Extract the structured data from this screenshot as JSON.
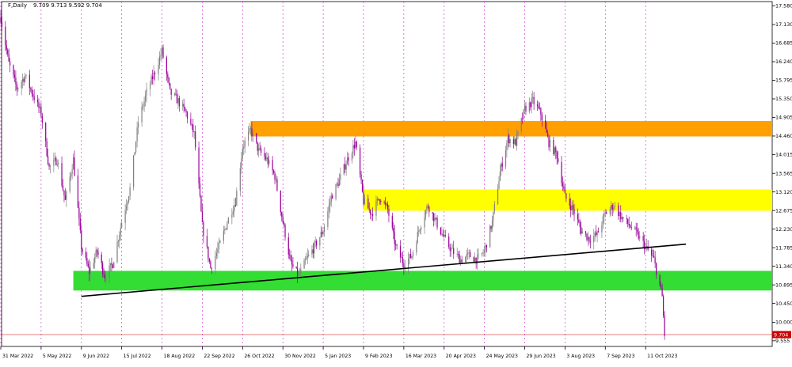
{
  "chart_data": {
    "type": "candlestick",
    "symbol": "F",
    "timeframe": "Daily",
    "header": {
      "label": "F,Daily",
      "ohlc_text": "9.709 9.713 9.592 9.704"
    },
    "current_price": 9.704,
    "current_price_label": "9.704",
    "ylim": [
      9.42,
      17.68
    ],
    "y_ticks": [
      "17.580",
      "17.130",
      "16.685",
      "16.240",
      "15.795",
      "15.350",
      "14.905",
      "14.460",
      "14.015",
      "13.565",
      "13.120",
      "12.675",
      "12.230",
      "11.785",
      "11.340",
      "10.895",
      "10.450",
      "10.000",
      "9.555"
    ],
    "x_ticks": [
      "31 Mar 2022",
      "5 May 2022",
      "9 Jun 2022",
      "15 Jul 2022",
      "18 Aug 2022",
      "22 Sep 2022",
      "26 Oct 2022",
      "30 Nov 2022",
      "5 Jan 2023",
      "9 Feb 2023",
      "16 Mar 2023",
      "20 Apr 2023",
      "24 May 2023",
      "29 Jun 2023",
      "3 Aug 2023",
      "7 Sep 2023",
      "11 Oct 2023"
    ],
    "price_path": [
      [
        "31 Mar 2022",
        17.3
      ],
      [
        "7 Apr 2022",
        16.2
      ],
      [
        "14 Apr 2022",
        15.6
      ],
      [
        "21 Apr 2022",
        15.9
      ],
      [
        "5 May 2022",
        15.0
      ],
      [
        "12 May 2022",
        13.7
      ],
      [
        "19 May 2022",
        13.9
      ],
      [
        "26 May 2022",
        12.9
      ],
      [
        "2 Jun 2022",
        13.9
      ],
      [
        "9 Jun 2022",
        11.8
      ],
      [
        "16 Jun 2022",
        11.2
      ],
      [
        "23 Jun 2022",
        11.7
      ],
      [
        "30 Jun 2022",
        11.1
      ],
      [
        "7 Jul 2022",
        11.4
      ],
      [
        "15 Jul 2022",
        12.4
      ],
      [
        "22 Jul 2022",
        13.2
      ],
      [
        "29 Jul 2022",
        14.8
      ],
      [
        "5 Aug 2022",
        15.5
      ],
      [
        "12 Aug 2022",
        16.0
      ],
      [
        "18 Aug 2022",
        16.5
      ],
      [
        "25 Aug 2022",
        15.5
      ],
      [
        "1 Sep 2022",
        15.3
      ],
      [
        "8 Sep 2022",
        15.0
      ],
      [
        "15 Sep 2022",
        14.5
      ],
      [
        "22 Sep 2022",
        12.3
      ],
      [
        "29 Sep 2022",
        11.3
      ],
      [
        "6 Oct 2022",
        11.8
      ],
      [
        "13 Oct 2022",
        12.4
      ],
      [
        "20 Oct 2022",
        12.9
      ],
      [
        "26 Oct 2022",
        14.2
      ],
      [
        "2 Nov 2022",
        14.6
      ],
      [
        "9 Nov 2022",
        14.1
      ],
      [
        "16 Nov 2022",
        13.9
      ],
      [
        "23 Nov 2022",
        13.5
      ],
      [
        "30 Nov 2022",
        12.4
      ],
      [
        "7 Dec 2022",
        11.4
      ],
      [
        "14 Dec 2022",
        11.1
      ],
      [
        "21 Dec 2022",
        11.5
      ],
      [
        "28 Dec 2022",
        11.8
      ],
      [
        "5 Jan 2023",
        12.2
      ],
      [
        "12 Jan 2023",
        13.0
      ],
      [
        "19 Jan 2023",
        13.4
      ],
      [
        "26 Jan 2023",
        13.9
      ],
      [
        "2 Feb 2023",
        14.3
      ],
      [
        "9 Feb 2023",
        12.9
      ],
      [
        "16 Feb 2023",
        12.6
      ],
      [
        "23 Feb 2023",
        13.0
      ],
      [
        "2 Mar 2023",
        12.7
      ],
      [
        "9 Mar 2023",
        11.8
      ],
      [
        "16 Mar 2023",
        11.4
      ],
      [
        "23 Mar 2023",
        11.6
      ],
      [
        "30 Mar 2023",
        12.3
      ],
      [
        "6 Apr 2023",
        12.8
      ],
      [
        "13 Apr 2023",
        12.4
      ],
      [
        "20 Apr 2023",
        12.0
      ],
      [
        "27 Apr 2023",
        11.7
      ],
      [
        "4 May 2023",
        11.5
      ],
      [
        "11 May 2023",
        11.6
      ],
      [
        "18 May 2023",
        11.5
      ],
      [
        "24 May 2023",
        11.7
      ],
      [
        "31 May 2023",
        12.4
      ],
      [
        "7 Jun 2023",
        13.6
      ],
      [
        "14 Jun 2023",
        14.4
      ],
      [
        "21 Jun 2023",
        14.3
      ],
      [
        "29 Jun 2023",
        15.1
      ],
      [
        "6 Jul 2023",
        15.3
      ],
      [
        "13 Jul 2023",
        15.0
      ],
      [
        "20 Jul 2023",
        14.3
      ],
      [
        "27 Jul 2023",
        14.0
      ],
      [
        "3 Aug 2023",
        13.0
      ],
      [
        "10 Aug 2023",
        12.7
      ],
      [
        "17 Aug 2023",
        12.2
      ],
      [
        "24 Aug 2023",
        12.0
      ],
      [
        "31 Aug 2023",
        12.1
      ],
      [
        "7 Sep 2023",
        12.6
      ],
      [
        "14 Sep 2023",
        12.8
      ],
      [
        "21 Sep 2023",
        12.5
      ],
      [
        "28 Sep 2023",
        12.3
      ],
      [
        "4 Oct 2023",
        12.1
      ],
      [
        "11 Oct 2023",
        11.8
      ],
      [
        "18 Oct 2023",
        11.5
      ],
      [
        "25 Oct 2023",
        10.6
      ],
      [
        "27 Oct 2023",
        9.7
      ]
    ],
    "zones": [
      {
        "name": "orange",
        "color": "#ffa000",
        "price_from": 14.45,
        "price_to": 14.82,
        "date_from": "2 Nov 2022"
      },
      {
        "name": "yellow",
        "color": "#ffff00",
        "price_from": 12.67,
        "price_to": 13.18,
        "date_from": "9 Feb 2023"
      },
      {
        "name": "green",
        "color": "#33dd33",
        "price_from": 10.76,
        "price_to": 11.23,
        "date_from": "2 Jun 2022"
      }
    ],
    "trendline": {
      "color": "#000000",
      "from": [
        "9 Jun 2022",
        10.62
      ],
      "to": [
        "14 Nov 2023",
        11.87
      ]
    },
    "colors": {
      "bull": "#808080",
      "bear": "#990099",
      "axis": "#7a007a",
      "price_line": "#cc0000",
      "price_label_bg": "#cc0000",
      "grid": "#cc44cc"
    }
  }
}
